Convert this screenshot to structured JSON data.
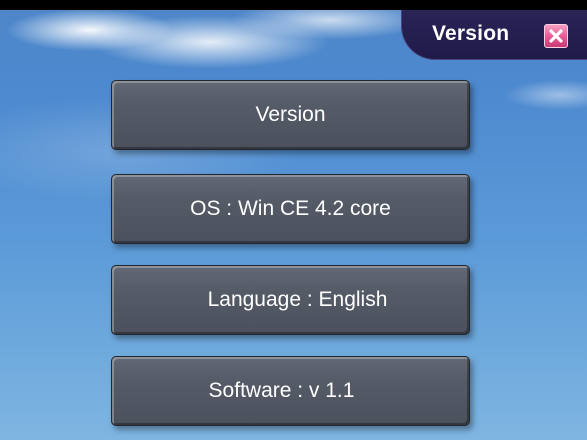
{
  "window": {
    "title": "Version"
  },
  "buttons": {
    "version": "Version",
    "os": "OS : Win CE 4.2 core",
    "language": "Language : English",
    "software": "Software : v 1.1"
  },
  "icons": {
    "close": "close-icon"
  },
  "colors": {
    "title_bar": "#221c4f",
    "close_button": "#e85d97",
    "button_face": "#555b67",
    "sky": "#4d89cf"
  }
}
